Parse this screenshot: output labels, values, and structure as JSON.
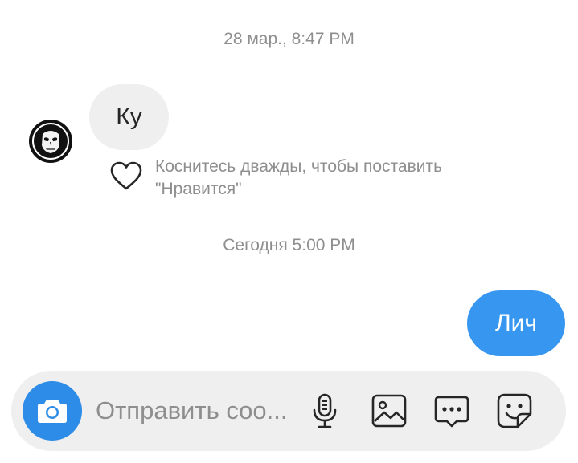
{
  "thread": {
    "timestamp_1": "28 мар., 8:47 PM",
    "incoming_message": "Ку",
    "like_hint_line1": "Коснитесь дважды, чтобы поставить",
    "like_hint_line2": "\"Нравится\"",
    "timestamp_2": "Сегодня 5:00 PM",
    "outgoing_message": "Лич"
  },
  "composer": {
    "placeholder": "Отправить соо...",
    "icons": [
      "camera-icon",
      "microphone-icon",
      "gallery-icon",
      "more-icon",
      "sticker-icon"
    ]
  },
  "colors": {
    "outgoing_bubble": "#3797f0",
    "camera_button": "#2d8ce8",
    "incoming_bubble": "#efefef",
    "muted_text": "#8e8e8e"
  }
}
